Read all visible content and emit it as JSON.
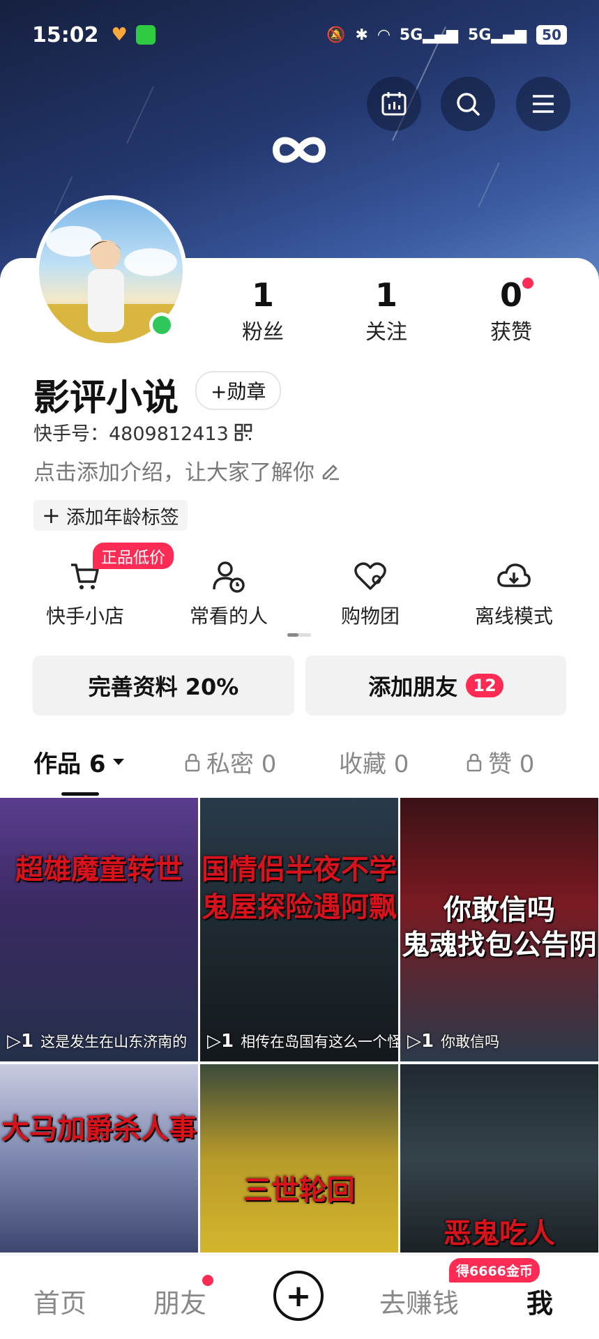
{
  "status": {
    "time": "15:02",
    "battery": "50"
  },
  "profile": {
    "name": "影评小说",
    "medal_label": "+勋章",
    "uid": "快手号：4809812413",
    "intro": "点击添加介绍，让大家了解你",
    "age_tag": "添加年龄标签"
  },
  "stats": [
    {
      "value": "1",
      "label": "粉丝"
    },
    {
      "value": "1",
      "label": "关注"
    },
    {
      "value": "0",
      "label": "获赞"
    }
  ],
  "functions": [
    {
      "label": "快手小店",
      "icon": "cart-icon"
    },
    {
      "label": "常看的人",
      "icon": "person-clock-icon"
    },
    {
      "label": "购物团",
      "icon": "heart-group-icon"
    },
    {
      "label": "离线模式",
      "icon": "cloud-download-icon"
    }
  ],
  "promo_badge": "正品低价",
  "buttons": {
    "complete_profile": "完善资料 20%",
    "add_friend": "添加朋友",
    "add_friend_count": "12"
  },
  "tabs": [
    {
      "label": "作品 6"
    },
    {
      "label": "私密 0"
    },
    {
      "label": "收藏 0"
    },
    {
      "label": "赞 0"
    }
  ],
  "videos": [
    {
      "caption": "超雄魔童转世",
      "bottom": "这是发生在山东济南的",
      "plays": "1"
    },
    {
      "caption": "国情侣半夜不学",
      "caption2": "鬼屋探险遇阿飘",
      "bottom": "相传在岛国有这么一个怪谈",
      "plays": "1"
    },
    {
      "caption": "你敢信吗",
      "caption2": "鬼魂找包公告阴",
      "bottom": "你敢信吗",
      "plays": "1"
    },
    {
      "caption": "大马加爵杀人事"
    },
    {
      "caption": "三世轮回"
    },
    {
      "caption": "恶鬼吃人"
    }
  ],
  "nav": {
    "home": "首页",
    "friends": "朋友",
    "earn": "去赚钱",
    "me": "我",
    "coins_badge": "得6666金币"
  },
  "colors": {
    "accent": "#fe2c55",
    "online": "#2fc75a"
  }
}
